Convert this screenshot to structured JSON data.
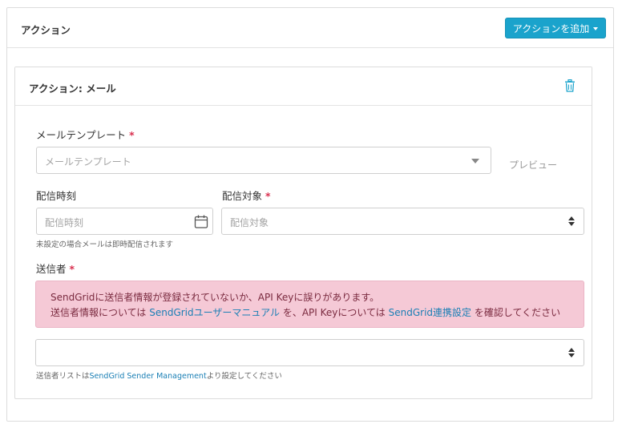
{
  "header": {
    "title": "アクション",
    "add_button_label": "アクションを追加"
  },
  "action": {
    "title": "アクション: メール",
    "mail_template": {
      "label": "メールテンプレート",
      "required_mark": "*",
      "placeholder": "メールテンプレート"
    },
    "preview_label": "プレビュー",
    "delivery_time": {
      "label": "配信時刻",
      "placeholder": "配信時刻",
      "hint": "未設定の場合メールは即時配信されます"
    },
    "delivery_target": {
      "label": "配信対象",
      "required_mark": "*",
      "placeholder": "配信対象"
    },
    "sender": {
      "label": "送信者",
      "required_mark": "*",
      "alert": {
        "line1": "SendGridに送信者情報が登録されていないか、API Keyに誤りがあります。",
        "line2_part1": "送信者情報については ",
        "link1": "SendGridユーザーマニュアル",
        "line2_part2": " を、API Keyについては ",
        "link2": "SendGrid連携設定",
        "line2_part3": " を確認してください"
      },
      "value": "",
      "hint_prefix": "送信者リストは",
      "hint_link": "SendGrid Sender Management",
      "hint_suffix": "より設定してください"
    }
  },
  "colors": {
    "accent": "#1aa3cc",
    "alert_bg": "#f5c9d6",
    "required": "#d9304f",
    "link": "#1a7fb5"
  },
  "icons": {
    "trash": "trash-icon",
    "calendar": "calendar-icon",
    "caret": "caret-down-icon"
  }
}
